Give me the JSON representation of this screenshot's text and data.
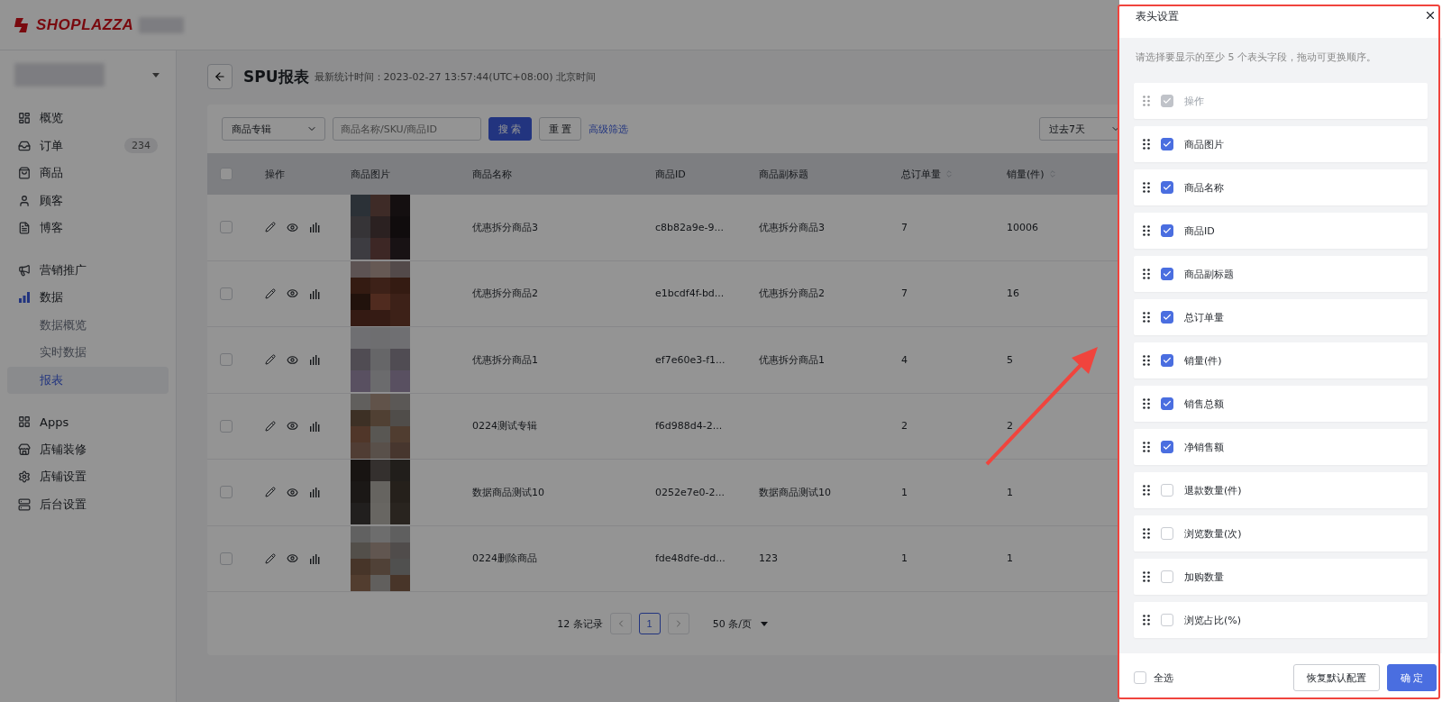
{
  "topbar": {
    "logo": "SHOPLAZZA"
  },
  "sidebar": {
    "groups": [
      [
        {
          "label": "概览",
          "selected": false
        },
        {
          "label": "订单",
          "badge": "234",
          "selected": false
        },
        {
          "label": "商品",
          "selected": false
        },
        {
          "label": "顾客",
          "selected": false
        },
        {
          "label": "博客",
          "selected": false
        }
      ],
      [
        {
          "label": "营销推广",
          "selected": false
        },
        {
          "label": "数据",
          "selected": true,
          "children": [
            {
              "label": "数据概览",
              "selected": false
            },
            {
              "label": "实时数据",
              "selected": false
            },
            {
              "label": "报表",
              "selected": true
            }
          ]
        }
      ],
      [
        {
          "label": "Apps",
          "selected": false
        },
        {
          "label": "店铺装修",
          "selected": false
        },
        {
          "label": "店铺设置",
          "selected": false
        },
        {
          "label": "后台设置",
          "selected": false
        }
      ]
    ]
  },
  "page": {
    "title": "SPU报表",
    "subtitle": "最新统计时间：2023-02-27 13:57:44(UTC+08:00) 北京时间"
  },
  "filters": {
    "collection_select": "商品专辑",
    "search": {
      "placeholder": "商品名称/SKU/商品ID"
    },
    "search_button": "搜 索",
    "reset_button": "重 置",
    "advanced_link": "高级筛选",
    "date_select": "过去7天"
  },
  "table": {
    "header_checked": false,
    "columns": [
      {
        "label": "操作",
        "sortable": false
      },
      {
        "label": "商品图片",
        "sortable": false
      },
      {
        "label": "商品名称",
        "sortable": false
      },
      {
        "label": "商品ID",
        "sortable": false
      },
      {
        "label": "商品副标题",
        "sortable": false
      },
      {
        "label": "总订单量",
        "sortable": true
      },
      {
        "label": "销量(件)",
        "sortable": true
      }
    ],
    "rows": [
      {
        "checked": false,
        "name": "优惠拆分商品3",
        "id": "c8b82a9e-9...",
        "subtitle": "优惠拆分商品3",
        "orders": "7",
        "sales": "10006"
      },
      {
        "checked": false,
        "name": "优惠拆分商品2",
        "id": "e1bcdf4f-bd...",
        "subtitle": "优惠拆分商品2",
        "orders": "7",
        "sales": "16"
      },
      {
        "checked": false,
        "name": "优惠拆分商品1",
        "id": "ef7e60e3-f1...",
        "subtitle": "优惠拆分商品1",
        "orders": "4",
        "sales": "5"
      },
      {
        "checked": false,
        "name": "0224测试专辑",
        "id": "f6d988d4-2...",
        "orders": "2",
        "sales": "2"
      },
      {
        "checked": false,
        "name": "数据商品测试10",
        "id": "0252e7e0-2...",
        "subtitle": "数据商品测试10",
        "orders": "1",
        "sales": "1"
      },
      {
        "checked": false,
        "name": "0224删除商品",
        "id": "fde48dfe-dd...",
        "subtitle": "123",
        "orders": "1",
        "sales": "1"
      }
    ]
  },
  "pagination": {
    "total": "12 条记录",
    "pages": [
      {
        "label": "1",
        "selected": true
      }
    ],
    "page_size": "50 条/页"
  },
  "drawer": {
    "title": "表头设置",
    "hint": "请选择要显示的至少 5 个表头字段，拖动可更换顺序。",
    "fields": [
      {
        "label": "操作",
        "checked": true,
        "disabled": true
      },
      {
        "label": "商品图片",
        "checked": true,
        "disabled": false
      },
      {
        "label": "商品名称",
        "checked": true,
        "disabled": false
      },
      {
        "label": "商品ID",
        "checked": true,
        "disabled": false
      },
      {
        "label": "商品副标题",
        "checked": true,
        "disabled": false
      },
      {
        "label": "总订单量",
        "checked": true,
        "disabled": false
      },
      {
        "label": "销量(件)",
        "checked": true,
        "disabled": false
      },
      {
        "label": "销售总额",
        "checked": true,
        "disabled": false
      },
      {
        "label": "净销售额",
        "checked": true,
        "disabled": false
      },
      {
        "label": "退款数量(件)",
        "checked": false,
        "disabled": false
      },
      {
        "label": "浏览数量(次)",
        "checked": false,
        "disabled": false
      },
      {
        "label": "加购数量",
        "checked": false,
        "disabled": false
      },
      {
        "label": "浏览占比(%)",
        "checked": false,
        "disabled": false
      }
    ],
    "select_all": {
      "label": "全选",
      "checked": false
    },
    "reset_button": "恢复默认配置",
    "confirm_button": "确 定"
  }
}
